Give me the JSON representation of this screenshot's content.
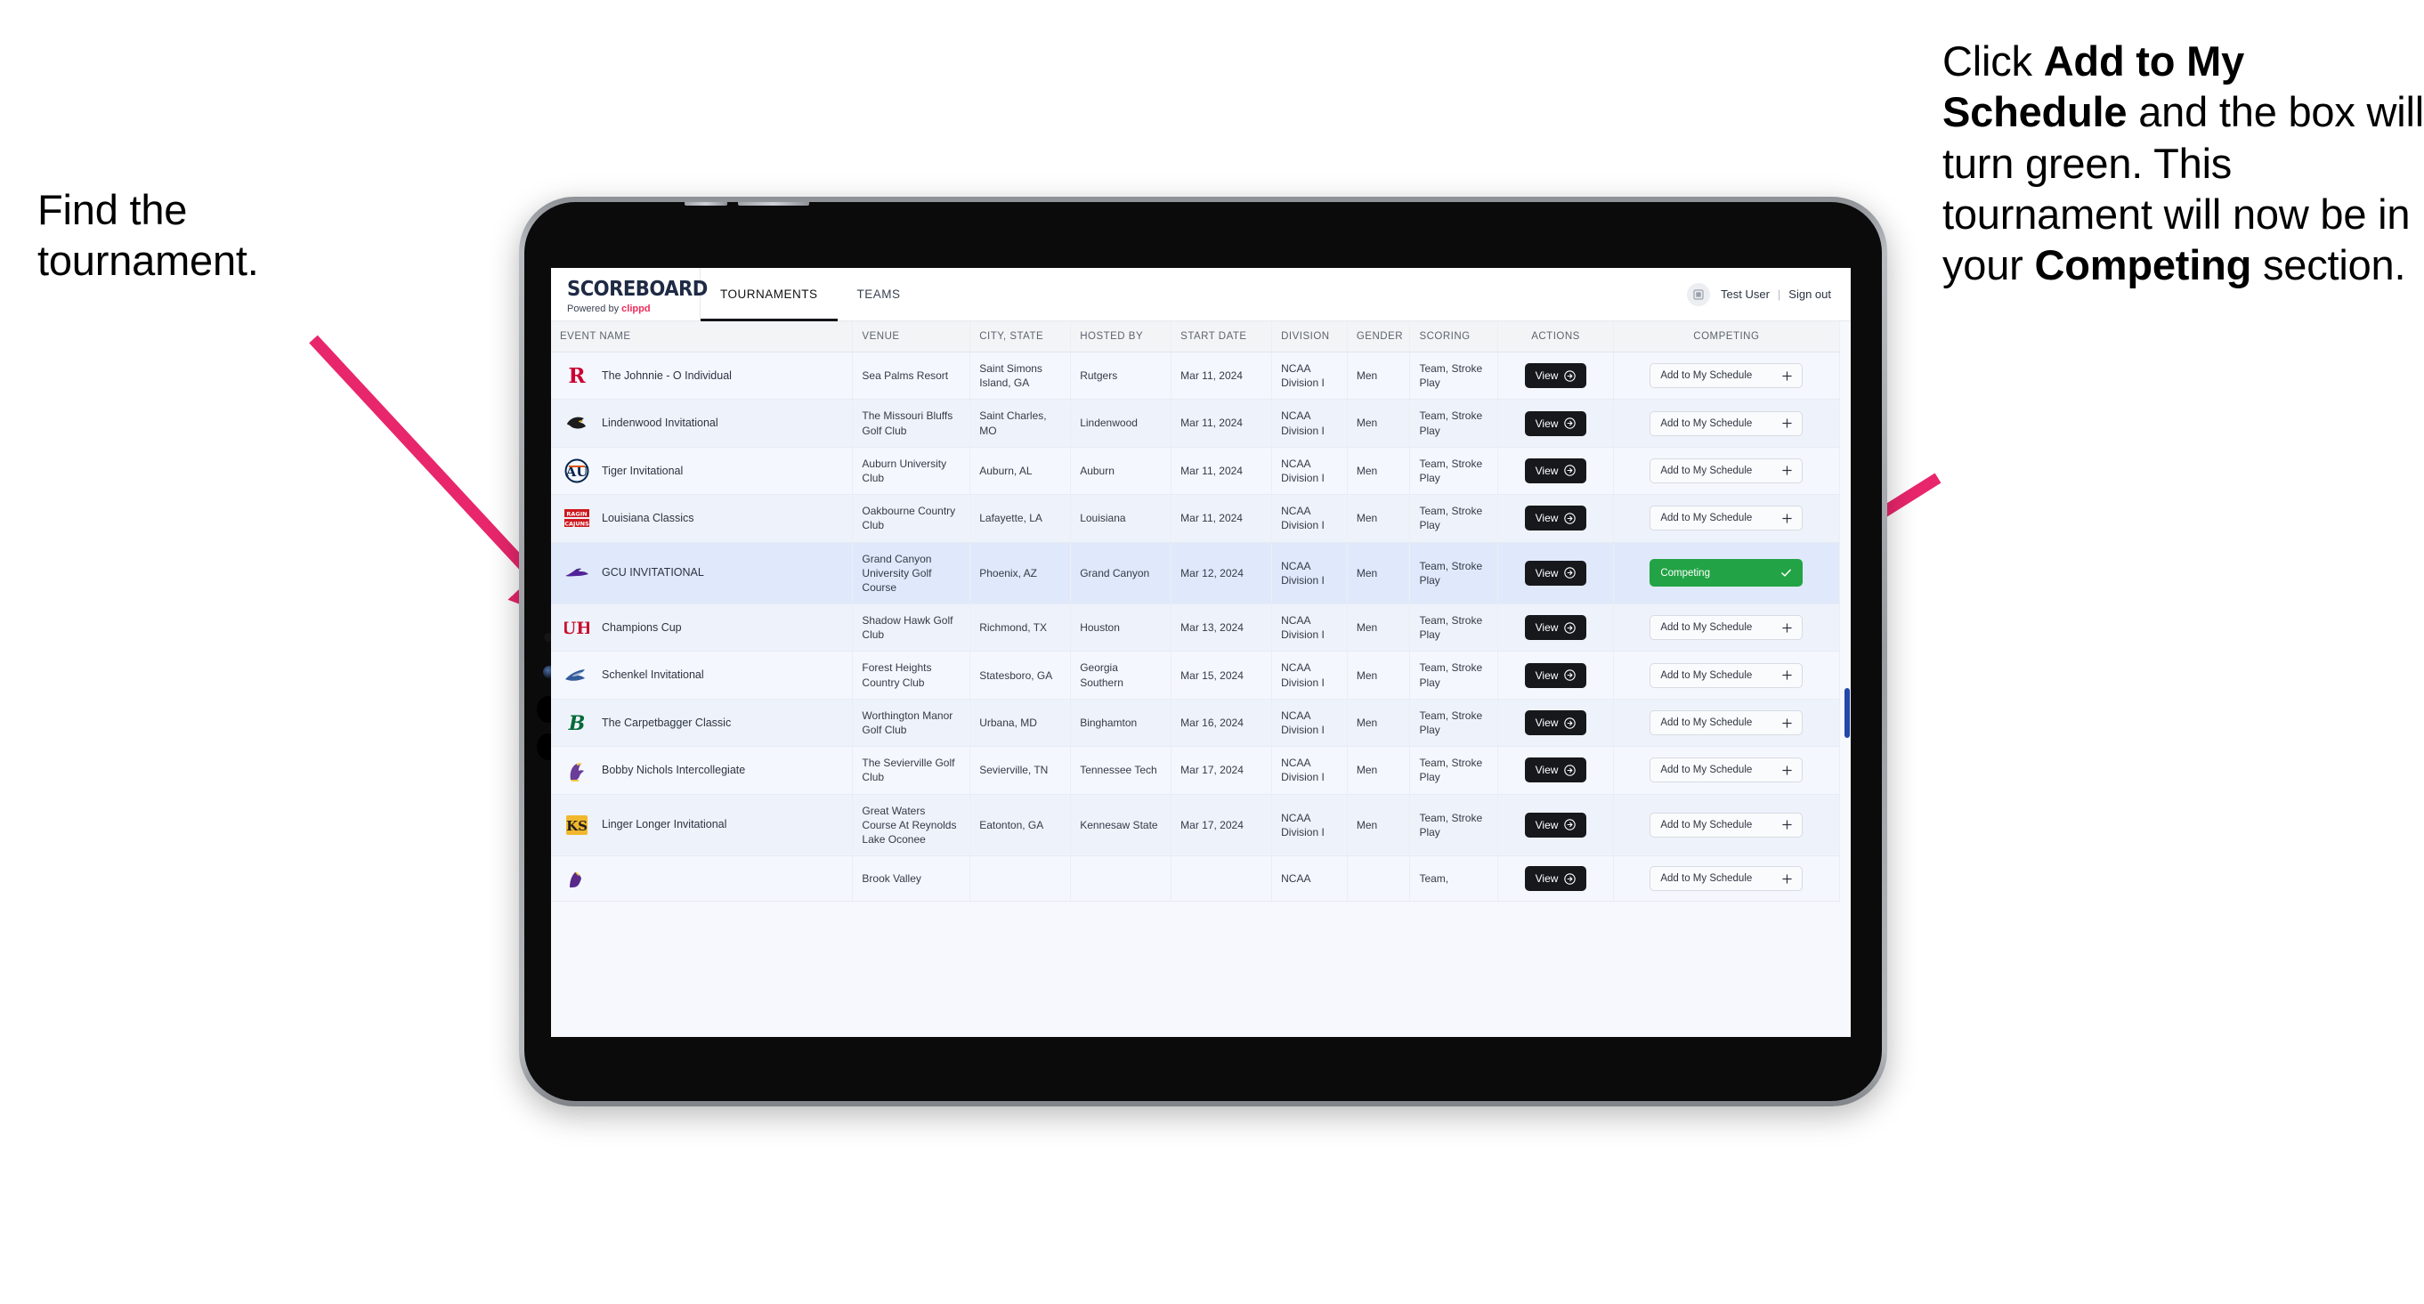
{
  "annotations": {
    "left": {
      "line1": "Find the",
      "line2": "tournament."
    },
    "right": {
      "seg1": "Click ",
      "bold1": "Add to My Schedule",
      "seg2": " and the box will turn green. This tournament will now be in your ",
      "bold2": "Competing",
      "seg3": " section."
    },
    "arrow_color": "#e8266c"
  },
  "app": {
    "brand": {
      "title": "SCOREBOARD",
      "powered_prefix": "Powered by ",
      "powered_brand": "clippd"
    },
    "nav": [
      {
        "label": "TOURNAMENTS",
        "active": true
      },
      {
        "label": "TEAMS",
        "active": false
      }
    ],
    "user": {
      "avatar_icon": "user-grid-icon",
      "name": "Test User",
      "separator": "|",
      "sign_out": "Sign out"
    }
  },
  "table": {
    "columns": [
      "EVENT NAME",
      "VENUE",
      "CITY, STATE",
      "HOSTED BY",
      "START DATE",
      "DIVISION",
      "GENDER",
      "SCORING",
      "ACTIONS",
      "COMPETING"
    ],
    "view_label": "View",
    "add_label": "Add to My Schedule",
    "add_icon": "plus-icon",
    "view_icon": "arrow-circle-right-icon",
    "competing_label": "Competing",
    "competing_icon": "check-icon",
    "competing_color": "#22a345",
    "rows": [
      {
        "logo": "rutgers-r-logo",
        "event": "The Johnnie - O Individual",
        "venue": "Sea Palms Resort",
        "city": "Saint Simons Island, GA",
        "host": "Rutgers",
        "date": "Mar 11, 2024",
        "division": "NCAA Division I",
        "gender": "Men",
        "scoring": "Team, Stroke Play",
        "competing": false,
        "selected": false
      },
      {
        "logo": "lindenwood-lion-logo",
        "event": "Lindenwood Invitational",
        "venue": "The Missouri Bluffs Golf Club",
        "city": "Saint Charles, MO",
        "host": "Lindenwood",
        "date": "Mar 11, 2024",
        "division": "NCAA Division I",
        "gender": "Men",
        "scoring": "Team, Stroke Play",
        "competing": false,
        "selected": false
      },
      {
        "logo": "auburn-au-logo",
        "event": "Tiger Invitational",
        "venue": "Auburn University Club",
        "city": "Auburn, AL",
        "host": "Auburn",
        "date": "Mar 11, 2024",
        "division": "NCAA Division I",
        "gender": "Men",
        "scoring": "Team, Stroke Play",
        "competing": false,
        "selected": false
      },
      {
        "logo": "louisiana-ragin-cajuns-logo",
        "event": "Louisiana Classics",
        "venue": "Oakbourne Country Club",
        "city": "Lafayette, LA",
        "host": "Louisiana",
        "date": "Mar 11, 2024",
        "division": "NCAA Division I",
        "gender": "Men",
        "scoring": "Team, Stroke Play",
        "competing": false,
        "selected": false
      },
      {
        "logo": "gcu-lopes-logo",
        "event": "GCU INVITATIONAL",
        "venue": "Grand Canyon University Golf Course",
        "city": "Phoenix, AZ",
        "host": "Grand Canyon",
        "date": "Mar 12, 2024",
        "division": "NCAA Division I",
        "gender": "Men",
        "scoring": "Team, Stroke Play",
        "competing": true,
        "selected": true
      },
      {
        "logo": "houston-uh-logo",
        "event": "Champions Cup",
        "venue": "Shadow Hawk Golf Club",
        "city": "Richmond, TX",
        "host": "Houston",
        "date": "Mar 13, 2024",
        "division": "NCAA Division I",
        "gender": "Men",
        "scoring": "Team, Stroke Play",
        "competing": false,
        "selected": false
      },
      {
        "logo": "georgia-southern-eagles-logo",
        "event": "Schenkel Invitational",
        "venue": "Forest Heights Country Club",
        "city": "Statesboro, GA",
        "host": "Georgia Southern",
        "date": "Mar 15, 2024",
        "division": "NCAA Division I",
        "gender": "Men",
        "scoring": "Team, Stroke Play",
        "competing": false,
        "selected": false
      },
      {
        "logo": "binghamton-b-logo",
        "event": "The Carpetbagger Classic",
        "venue": "Worthington Manor Golf Club",
        "city": "Urbana, MD",
        "host": "Binghamton",
        "date": "Mar 16, 2024",
        "division": "NCAA Division I",
        "gender": "Men",
        "scoring": "Team, Stroke Play",
        "competing": false,
        "selected": false
      },
      {
        "logo": "tennessee-tech-eagle-logo",
        "event": "Bobby Nichols Intercollegiate",
        "venue": "The Sevierville Golf Club",
        "city": "Sevierville, TN",
        "host": "Tennessee Tech",
        "date": "Mar 17, 2024",
        "division": "NCAA Division I",
        "gender": "Men",
        "scoring": "Team, Stroke Play",
        "competing": false,
        "selected": false
      },
      {
        "logo": "kennesaw-state-ksu-logo",
        "event": "Linger Longer Invitational",
        "venue": "Great Waters Course At Reynolds Lake Oconee",
        "city": "Eatonton, GA",
        "host": "Kennesaw State",
        "date": "Mar 17, 2024",
        "division": "NCAA Division I",
        "gender": "Men",
        "scoring": "Team, Stroke Play",
        "competing": false,
        "selected": false
      },
      {
        "logo": "east-carolina-pirates-logo",
        "event": "",
        "venue": "Brook Valley",
        "city": "",
        "host": "",
        "date": "",
        "division": "NCAA",
        "gender": "",
        "scoring": "Team,",
        "competing": false,
        "selected": false
      }
    ]
  }
}
